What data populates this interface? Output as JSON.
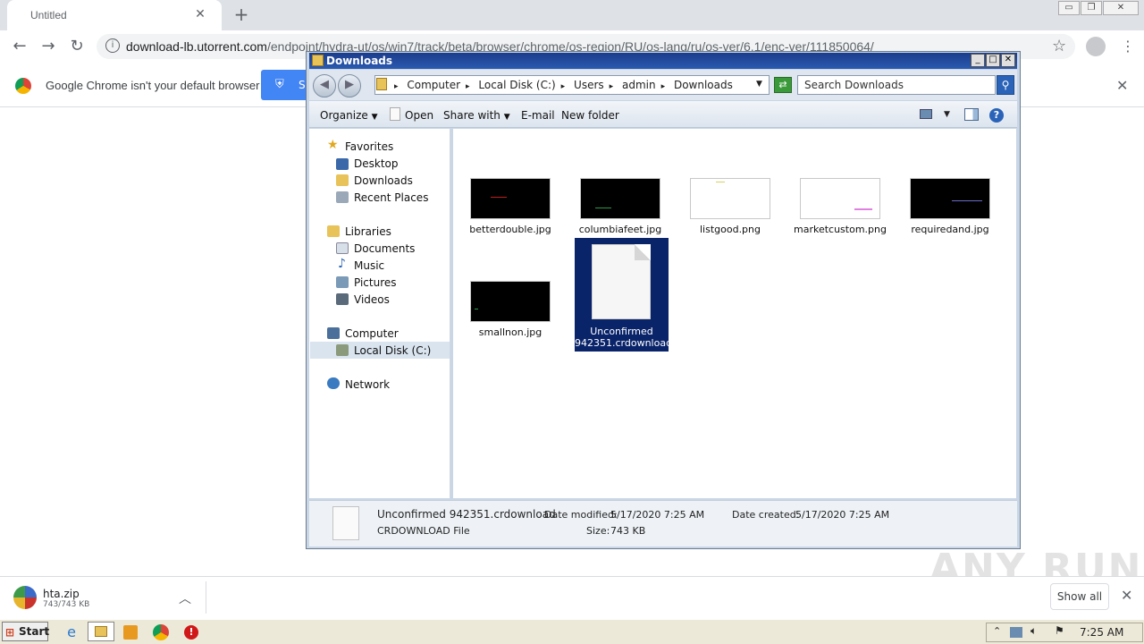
{
  "chrome": {
    "tab_title": "Untitled",
    "url_host": "download-lb.utorrent.com",
    "url_path": "/endpoint/hydra-ut/os/win7/track/beta/browser/chrome/os-region/RU/os-lang/ru/os-ver/6.1/enc-ver/111850064/",
    "infobar_text": "Google Chrome isn't your default browser",
    "infobar_button": "S"
  },
  "explorer": {
    "title": "Downloads",
    "breadcrumbs": [
      "Computer",
      "Local Disk (C:)",
      "Users",
      "admin",
      "Downloads"
    ],
    "search_placeholder": "Search Downloads",
    "commands": {
      "organize": "Organize",
      "open": "Open",
      "share": "Share with",
      "email": "E-mail",
      "new_folder": "New folder"
    },
    "nav": {
      "favorites": "Favorites",
      "desktop": "Desktop",
      "downloads": "Downloads",
      "recent": "Recent Places",
      "libraries": "Libraries",
      "documents": "Documents",
      "music": "Music",
      "pictures": "Pictures",
      "videos": "Videos",
      "computer": "Computer",
      "local_disk": "Local Disk (C:)",
      "network": "Network"
    },
    "files": [
      "betterdouble.jpg",
      "columbiafeet.jpg",
      "listgood.png",
      "marketcustom.png",
      "requiredand.jpg",
      "smallnon.jpg"
    ],
    "selected_file_line1": "Unconfirmed",
    "selected_file_line2": "942351.crdownload",
    "details": {
      "name": "Unconfirmed 942351.crdownload",
      "type": "CRDOWNLOAD File",
      "modified_label": "Date modified:",
      "modified": "5/17/2020 7:25 AM",
      "created_label": "Date created:",
      "created": "5/17/2020 7:25 AM",
      "size_label": "Size:",
      "size": "743 KB"
    }
  },
  "shelf": {
    "file_name": "hta.zip",
    "file_size": "743/743 KB",
    "show_all": "Show all"
  },
  "watermark": "ANY RUN",
  "taskbar": {
    "start": "Start",
    "clock": "7:25 AM"
  }
}
